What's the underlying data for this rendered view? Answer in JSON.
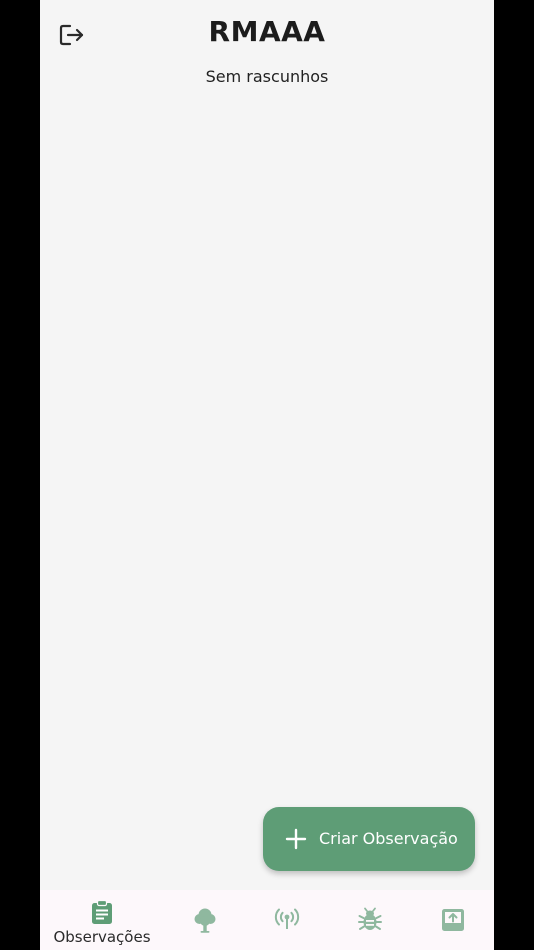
{
  "header": {
    "title": "RMAAA",
    "logout_icon": "logout-icon"
  },
  "main": {
    "empty_message": "Sem rascunhos"
  },
  "fab": {
    "label": "Criar Observação",
    "icon": "plus-icon"
  },
  "bottom_nav": {
    "items": [
      {
        "label": "Observações",
        "icon": "clipboard-icon",
        "active": true
      },
      {
        "label": "",
        "icon": "tree-icon",
        "active": false
      },
      {
        "label": "",
        "icon": "antenna-icon",
        "active": false
      },
      {
        "label": "",
        "icon": "bug-icon",
        "active": false
      },
      {
        "label": "",
        "icon": "upload-box-icon",
        "active": false
      }
    ]
  },
  "colors": {
    "accent": "#5e9d76",
    "accent_light": "#8fb89f",
    "background": "#f5f5f5",
    "nav_background": "#fdf8fb"
  }
}
